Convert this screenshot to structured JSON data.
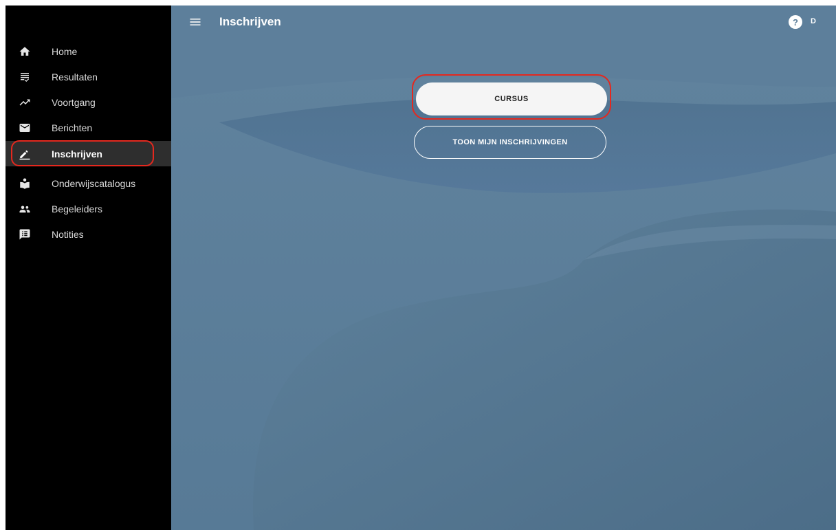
{
  "header": {
    "title": "Inschrijven",
    "help_label": "?",
    "user_initial": "D"
  },
  "sidebar": {
    "items": [
      {
        "label": "Home",
        "icon": "home-icon"
      },
      {
        "label": "Resultaten",
        "icon": "list-check-icon"
      },
      {
        "label": "Voortgang",
        "icon": "trending-up-icon"
      },
      {
        "label": "Berichten",
        "icon": "mail-icon"
      },
      {
        "label": "Inschrijven",
        "icon": "edit-pen-icon",
        "active": true
      },
      {
        "label": "Onderwijscatalogus",
        "icon": "reading-person-icon"
      },
      {
        "label": "Begeleiders",
        "icon": "people-icon"
      },
      {
        "label": "Notities",
        "icon": "note-icon"
      }
    ]
  },
  "main": {
    "primary_button": "CURSUS",
    "secondary_button": "TOON MIJN INSCHRIJVINGEN"
  },
  "colors": {
    "sidebar_bg": "#000000",
    "active_item_bg": "#2e2e2e",
    "main_bg": "#5a7d99",
    "highlight": "#e5281e"
  }
}
